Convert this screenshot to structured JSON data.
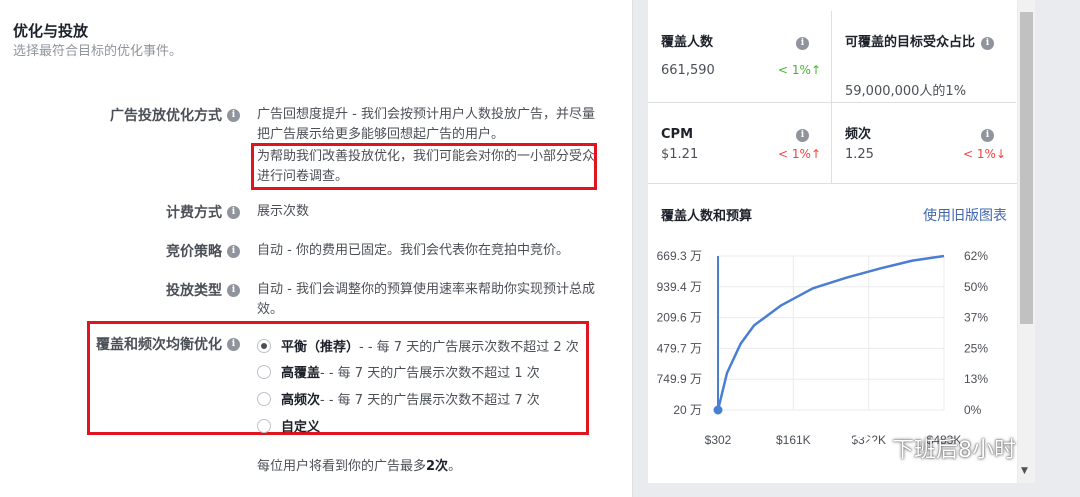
{
  "left": {
    "title": "优化与投放",
    "subtitle": "选择最符合目标的优化事件。",
    "optimization": {
      "label": "广告投放优化方式",
      "value": "广告回想度提升 - 我们会按预计用户人数投放广告，并尽量把广告展示给更多能够回想起广告的用户。",
      "survey_note": "为帮助我们改善投放优化，我们可能会对你的一小部分受众进行问卷调查。"
    },
    "billing": {
      "label": "计费方式",
      "value": "展示次数"
    },
    "bid": {
      "label": "竞价策略",
      "value": "自动 - 你的费用已固定。我们会代表你在竞拍中竞价。"
    },
    "delivery": {
      "label": "投放类型",
      "value": "自动 - 我们会调整你的预算使用速率来帮助你实现预计总成效。"
    },
    "frequency": {
      "label": "覆盖和频次均衡优化",
      "options": [
        {
          "name": "平衡（推荐）",
          "desc": " - - 每 7 天的广告展示次数不超过 2 次",
          "selected": true
        },
        {
          "name": "高覆盖",
          "desc": " - - 每 7 天的广告展示次数不超过 1 次",
          "selected": false
        },
        {
          "name": "高频次",
          "desc": " - - 每 7 天的广告展示次数不超过 7 次",
          "selected": false
        },
        {
          "name": "自定义",
          "desc": "",
          "selected": false
        }
      ],
      "note_prefix": "每位用户将看到你的广告最多",
      "note_bold": "2次",
      "note_suffix": "。"
    }
  },
  "stats": {
    "reach": {
      "title": "覆盖人数",
      "value": "661,590",
      "change": "< 1%↑"
    },
    "audience": {
      "title": "可覆盖的目标受众占比",
      "value": "59,000,000人的1%"
    },
    "cpm": {
      "title": "CPM",
      "value": "$1.21",
      "change": "< 1%↑"
    },
    "freq": {
      "title": "频次",
      "value": "1.25",
      "change": "< 1%↓"
    }
  },
  "chart": {
    "title": "覆盖人数和预算",
    "link": "使用旧版图表",
    "info_glyph": "i",
    "scroll_arrow": "▼"
  },
  "chart_data": {
    "type": "line",
    "title": "覆盖人数和预算",
    "y_ticks_left": [
      "669.3 万",
      "939.4 万",
      "209.6 万",
      "479.7 万",
      "749.9 万",
      "20 万"
    ],
    "y_ticks_right": [
      "62%",
      "50%",
      "37%",
      "25%",
      "13%",
      "0%"
    ],
    "x_ticks": [
      "$302",
      "$161K",
      "$322K",
      "$483K"
    ],
    "x": [
      0,
      0.04,
      0.1,
      0.16,
      0.28,
      0.42,
      0.57,
      0.72,
      0.86,
      1.0
    ],
    "y": [
      0,
      0.24,
      0.43,
      0.55,
      0.68,
      0.79,
      0.86,
      0.92,
      0.97,
      1.0
    ],
    "start_point": true,
    "grid": true,
    "line_color": "#4a7ed3"
  },
  "watermark": {
    "text": "下班后8小时"
  },
  "colors": {
    "highlight_box": "#e0141e",
    "link": "#4267b2",
    "up": "#42b72a",
    "down": "#fa3e3e"
  }
}
